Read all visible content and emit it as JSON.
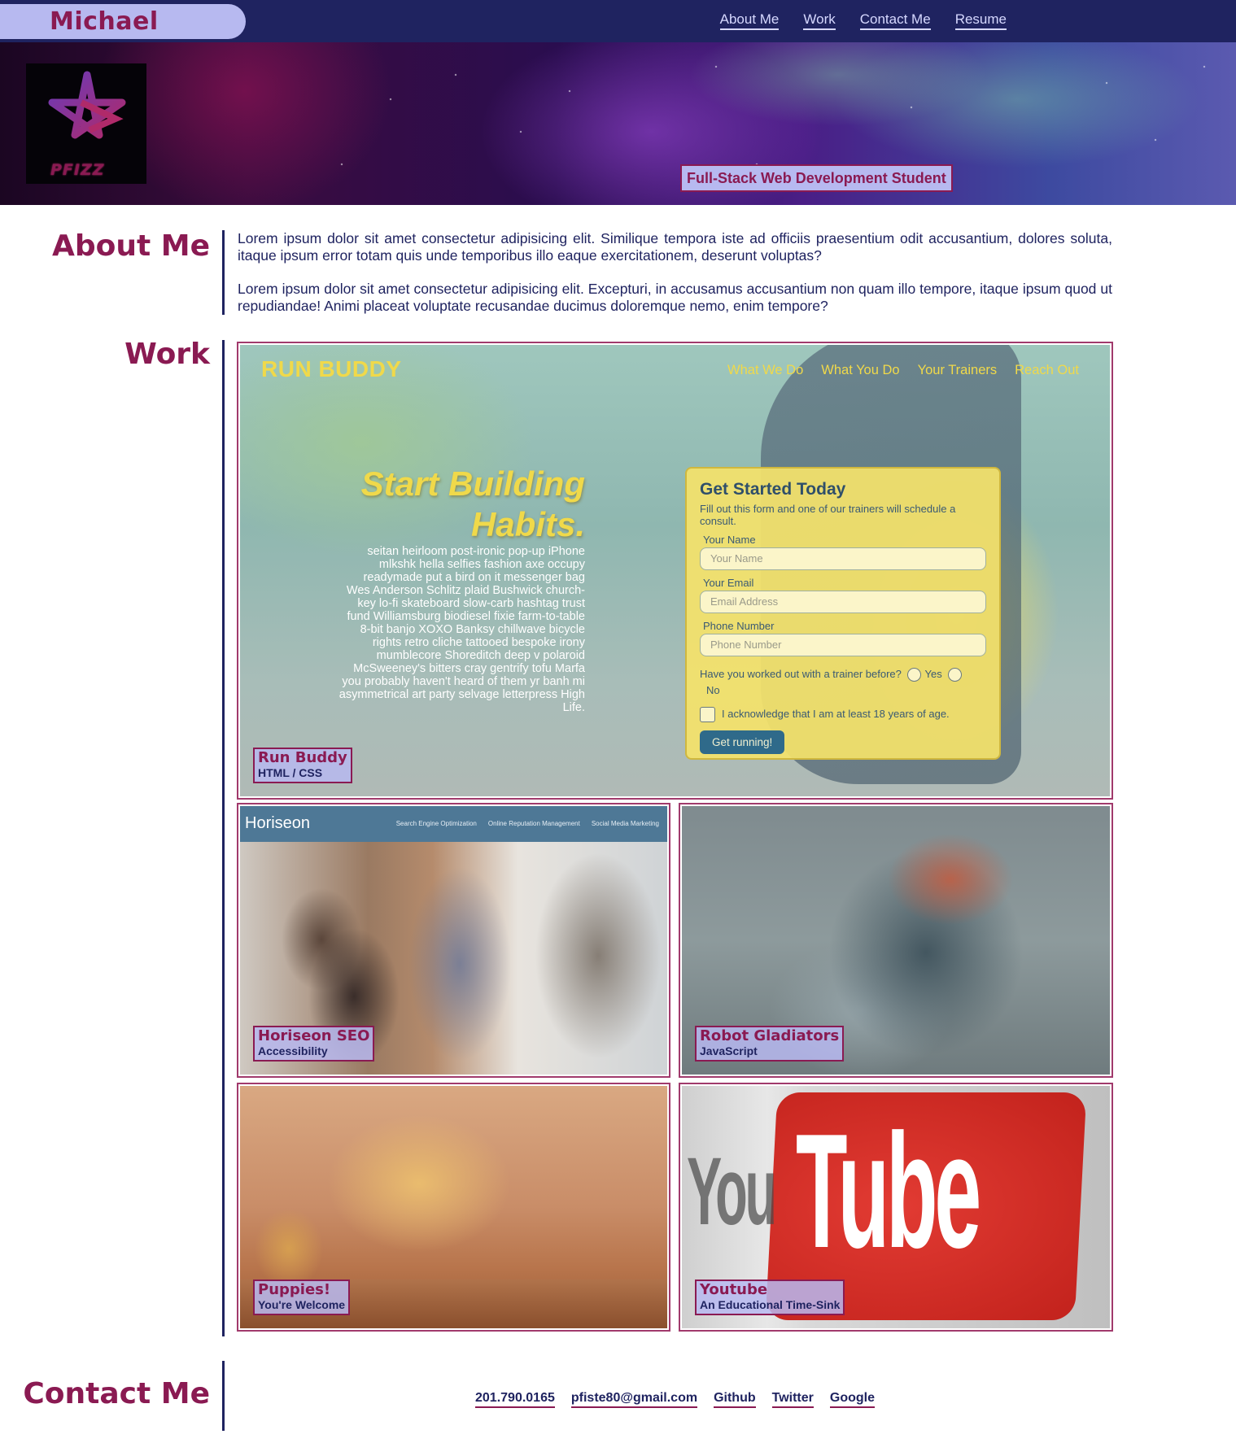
{
  "header": {
    "brand": "Michael Pfister",
    "nav": [
      "About Me",
      "Work",
      "Contact Me",
      "Resume"
    ],
    "logo_text": "PFIZZ",
    "tagline": "Full-Stack Web Development Student"
  },
  "about": {
    "title": "About Me",
    "paragraphs": [
      "Lorem ipsum dolor sit amet consectetur adipisicing elit. Similique tempora iste ad officiis praesentium odit accusantium, dolores soluta, itaque ipsum error totam quis unde temporibus illo eaque exercitationem, deserunt voluptas?",
      "Lorem ipsum dolor sit amet consectetur adipisicing elit. Excepturi, in accusamus accusantium non quam illo tempore, itaque ipsum quod ut repudiandae! Animi placeat voluptate recusandae ducimus doloremque nemo, enim tempore?"
    ]
  },
  "work": {
    "title": "Work",
    "projects": [
      {
        "title": "Run Buddy",
        "subtitle": "HTML / CSS"
      },
      {
        "title": "Horiseon SEO",
        "subtitle": "Accessibility"
      },
      {
        "title": "Robot Gladiators",
        "subtitle": "JavaScript"
      },
      {
        "title": "Puppies!",
        "subtitle": "You're Welcome"
      },
      {
        "title": "Youtube",
        "subtitle": "An Educational Time-Sink"
      }
    ],
    "run_buddy_preview": {
      "logo": "RUN BUDDY",
      "nav": [
        "What We Do",
        "What You Do",
        "Your Trainers",
        "Reach Out"
      ],
      "heading_line1": "Start Building",
      "heading_line2": "Habits.",
      "paragraph": "seitan heirloom post-ironic pop-up iPhone mlkshk hella selfies fashion axe occupy readymade put a bird on it messenger bag Wes Anderson Schlitz plaid Bushwick church-key lo-fi skateboard slow-carb hashtag trust fund Williamsburg biodiesel fixie farm-to-table 8-bit banjo XOXO Banksy chillwave bicycle rights retro cliche tattooed bespoke irony mumblecore Shoreditch deep v polaroid McSweeney's bitters cray gentrify tofu Marfa you probably haven't heard of them yr banh mi asymmetrical art party selvage letterpress High Life.",
      "form_title": "Get Started Today",
      "form_hint": "Fill out this form and one of our trainers will schedule a consult.",
      "name_label": "Your Name",
      "name_placeholder": "Your Name",
      "email_label": "Your Email",
      "email_placeholder": "Email Address",
      "phone_label": "Phone Number",
      "phone_placeholder": "Phone Number",
      "radio_question": "Have you worked out with a trainer before?",
      "radio_yes": "Yes",
      "radio_no": "No",
      "checkbox_label": "I acknowledge that I am at least 18 years of age.",
      "button": "Get running!"
    },
    "horiseon_preview": {
      "logo": "Horiseon",
      "nav": [
        "Search Engine Optimization",
        "Online Reputation Management",
        "Social Media Marketing"
      ]
    },
    "youtube_preview": {
      "you": "You",
      "tube": "Tube"
    }
  },
  "contact": {
    "title": "Contact Me",
    "links": [
      "201.790.0165",
      "pfiste80@gmail.com",
      "Github",
      "Twitter",
      "Google"
    ]
  },
  "colors": {
    "navy": "#1f2360",
    "maroon": "#8a1a52",
    "lavender": "#b7b9f0"
  }
}
